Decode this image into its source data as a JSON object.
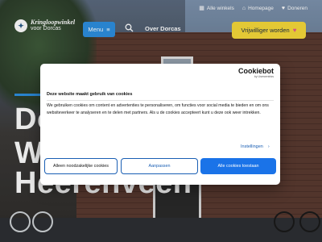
{
  "header": {
    "top_links": [
      {
        "icon": "grid-icon",
        "label": "Alle winkels"
      },
      {
        "icon": "home-icon",
        "label": "Homepage"
      },
      {
        "icon": "heart-icon",
        "label": "Doneren"
      }
    ],
    "logo": {
      "line1": "Kringloopwinkel",
      "line2": "voor Dorcas"
    },
    "menu_label": "Menu",
    "search_icon": "search-icon",
    "nav_link": "Over Dorcas",
    "volunteer_label": "Vrijwilliger worden"
  },
  "hero": {
    "lines": [
      "Do",
      "Wi",
      "Heerenveen"
    ]
  },
  "cookie_dialog": {
    "brand": "Cookiebot",
    "brand_sub": "by Usercentrics",
    "title": "Deze website maakt gebruik van cookies",
    "body": "We gebruiken cookies om content en advertenties te personaliseren, om functies voor social media te bieden en om ons websiteverkeer te analyseren en te delen met partners. Als u de cookies accepteert kunt u deze ook weer intrekken.",
    "settings_label": "Instellingen",
    "buttons": {
      "deny": "Alleen noodzakelijke cookies",
      "customize": "Aanpassen",
      "allow": "Alle cookies toestaan"
    }
  },
  "colors": {
    "accent_blue": "#2d8fe0",
    "volunteer_yellow": "#f7d93a",
    "cookie_blue": "#1a73e8"
  }
}
